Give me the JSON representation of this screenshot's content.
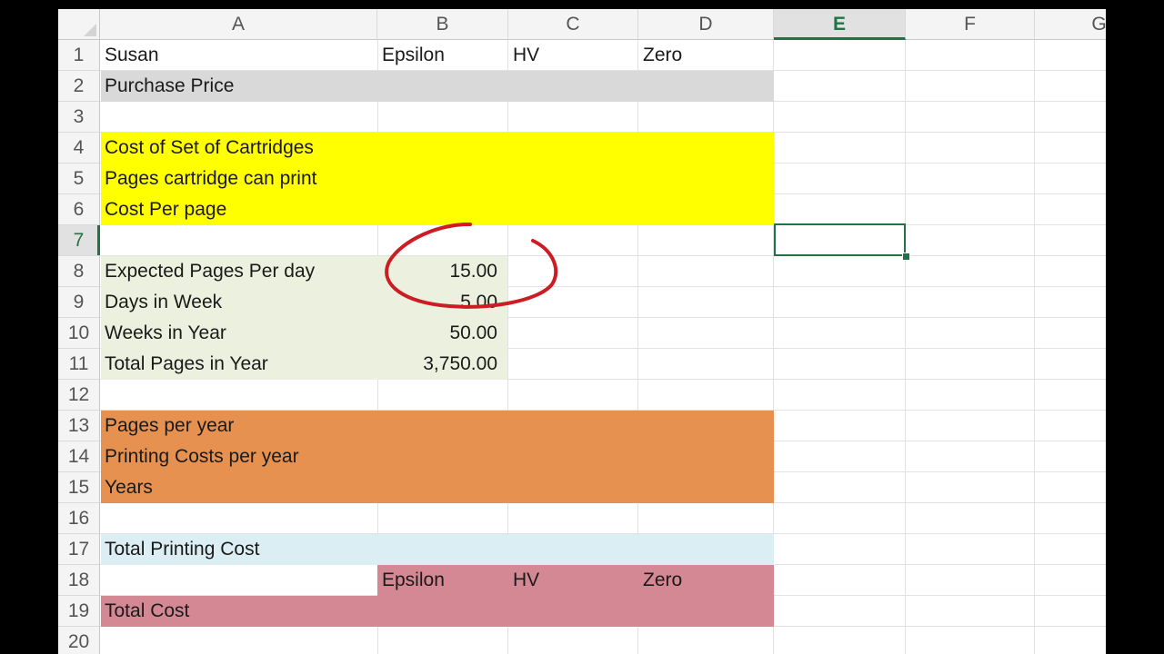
{
  "columns": [
    "A",
    "B",
    "C",
    "D",
    "E",
    "F",
    "G"
  ],
  "selected_column": "E",
  "rows": [
    "1",
    "2",
    "3",
    "4",
    "5",
    "6",
    "7",
    "8",
    "9",
    "10",
    "11",
    "12",
    "13",
    "14",
    "15",
    "16",
    "17",
    "18",
    "19",
    "20"
  ],
  "selected_row": "7",
  "active_cell": "E7",
  "cells": {
    "A1": "Susan",
    "B1": "Epsilon",
    "C1": "HV",
    "D1": "Zero",
    "A2": "Purchase Price",
    "A4": "Cost of Set of Cartridges",
    "A5": "Pages cartridge can print",
    "A6": "Cost Per page",
    "A8": "Expected Pages Per day",
    "B8": "15.00",
    "A9": "Days in Week",
    "B9": "5.00",
    "A10": "Weeks in Year",
    "B10": "50.00",
    "A11": "Total Pages in Year",
    "B11": "3,750.00",
    "A13": "Pages per year",
    "A14": "Printing Costs per year",
    "A15": "Years",
    "A17": "Total Printing Cost",
    "B18": "Epsilon",
    "C18": "HV",
    "D18": "Zero",
    "A19": "Total Cost"
  },
  "fill_colors": {
    "purchase_price_row": "#d9d9d9",
    "cartridge_block": "#ffff00",
    "pages_block": "#ebf1de",
    "yearly_block": "#e6914f",
    "total_printing_row": "#dbeef3",
    "total_cost_block": "#d48894"
  },
  "accent_color": "#217346",
  "annotation_color": "#cc1c24"
}
